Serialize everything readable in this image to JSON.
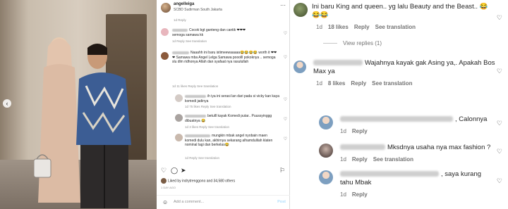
{
  "post": {
    "username": "angelleiga",
    "location": "SCBD Sudirman South Jakarta",
    "time_meta": "1d  Reply",
    "comments": [
      {
        "text": "Cocok bgt ganteng dan cantik ❤❤❤",
        "sub": "semoga samawa kk",
        "meta": "1d  Reply  See translation"
      },
      {
        "text": "Naaahh ini baru istimeewaaaaa😂😂😂😂 worth it ❤❤❤ Samawa mba Angel Lelga Samawa pooolll pokoknya .. semoga slu dlm ridhonya Allah dan syafaat nya rasulullah",
        "meta": "1d  11 likes  Reply  See translation"
      },
      {
        "text": "ih iya ini serasi lan dari pada si vicky kan kaya komedi jadinya",
        "meta": "1d  75 likes  Reply  See translation"
      },
      {
        "text": "betulll kayak Komedi putar.. Puussyinggg dibuatnya 😂",
        "meta": "1d  3 likes  Reply  See translation"
      },
      {
        "text": "mungkin mbak angel nyobain maen komedi dulu kan, akhirnya sekarang alhamdulilah klaten nominal lagi dan berkelas😂",
        "meta": "1d  Reply  See translation"
      }
    ],
    "liked_by": "Liked by indrytrenggono and 34,580 others",
    "time_ago": "1 DAY AGO",
    "add_comment_placeholder": "Add a comment...",
    "post_label": "Post"
  },
  "zoom": {
    "comments": [
      {
        "text": "Ini baru King and queen.. yg lalu Beauty and the Beast.. 😂😂😂",
        "time": "1d",
        "likes": "18 likes",
        "reply": "Reply",
        "translate": "See translation"
      },
      {
        "text": "Wajahnya kayak gak Asing ya,. Apakah Bos Max ya",
        "time": "1d",
        "likes": "8 likes",
        "reply": "Reply",
        "translate": "See translation"
      },
      {
        "text": ", Calonnya",
        "time": "1d",
        "reply": "Reply"
      },
      {
        "text": "Mksdnya usaha nya max fashion ?",
        "time": "1d",
        "reply": "Reply",
        "translate": "See translation"
      },
      {
        "text": ", saya kurang tahu Mbak",
        "time": "1d",
        "reply": "Reply"
      }
    ],
    "view_replies": "View replies (1)",
    "view_replies_2": "View replies (1)"
  },
  "colors": {
    "meta": "#737373",
    "text": "#262626",
    "border": "#dbdbdb"
  },
  "icons": [
    "heart-icon",
    "comment-icon",
    "share-icon",
    "bookmark-icon",
    "emoji-icon",
    "more-icon",
    "chevron-left-icon"
  ]
}
